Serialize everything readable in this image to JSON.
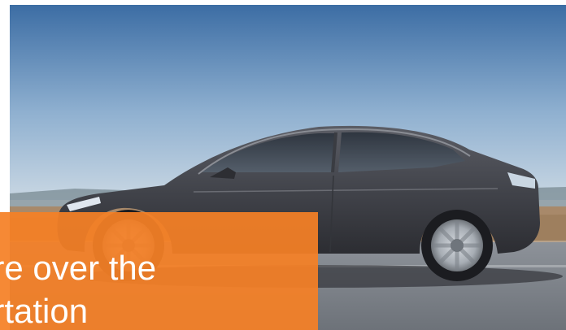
{
  "hero": {
    "image_icon": "car-photo-icon"
  },
  "caption": {
    "line1": "ore over the",
    "line2": "ortation"
  },
  "colors": {
    "caption_bg": "#F58026",
    "caption_text": "#FFFFFF",
    "sky_top": "#3E6FA6",
    "car_body": "#4A4B52"
  }
}
